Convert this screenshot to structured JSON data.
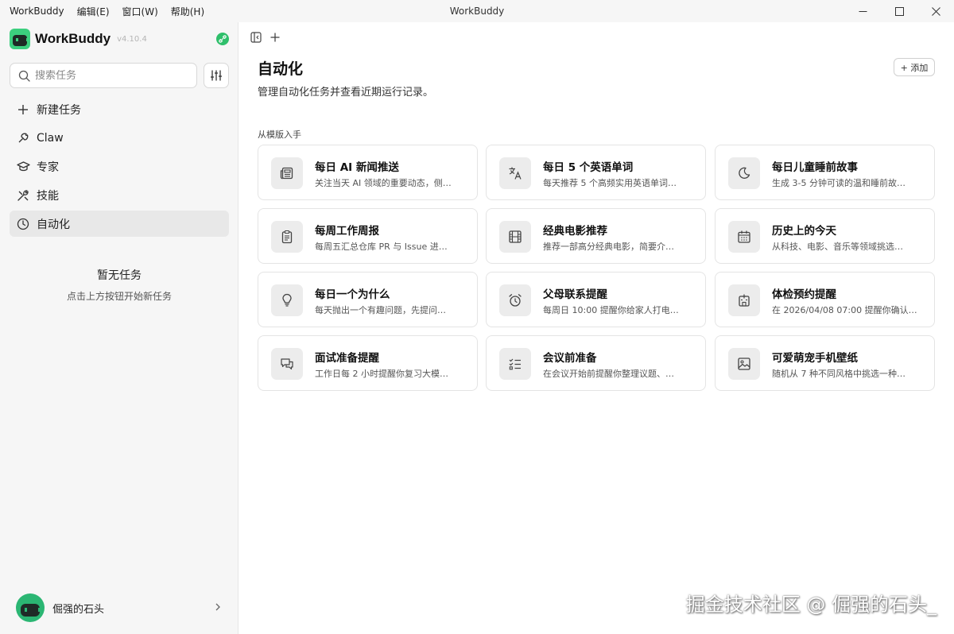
{
  "titlebar": {
    "app_title": "WorkBuddy",
    "menu": [
      "WorkBuddy",
      "编辑(E)",
      "窗口(W)",
      "帮助(H)"
    ]
  },
  "sidebar": {
    "brand": "WorkBuddy",
    "version": "v4.10.4",
    "search_placeholder": "搜索任务",
    "items": [
      {
        "label": "新建任务",
        "icon": "plus-icon"
      },
      {
        "label": "Claw",
        "icon": "claw-icon"
      },
      {
        "label": "专家",
        "icon": "graduation-cap-icon"
      },
      {
        "label": "技能",
        "icon": "tools-icon"
      },
      {
        "label": "自动化",
        "icon": "clock-icon",
        "active": true
      }
    ],
    "empty_title": "暂无任务",
    "empty_subtitle": "点击上方按钮开始新任务",
    "user_name": "倔强的石头"
  },
  "main": {
    "title": "自动化",
    "description": "管理自动化任务并查看近期运行记录。",
    "add_label": "+ 添加",
    "section_label": "从模版入手",
    "templates": [
      {
        "title": "每日 AI 新闻推送",
        "desc": "关注当天 AI 领域的重要动态，侧…",
        "icon": "newspaper-icon"
      },
      {
        "title": "每日 5 个英语单词",
        "desc": "每天推荐 5 个高频实用英语单词…",
        "icon": "translate-icon"
      },
      {
        "title": "每日儿童睡前故事",
        "desc": "生成 3-5 分钟可读的温和睡前故…",
        "icon": "moon-icon"
      },
      {
        "title": "每周工作周报",
        "desc": "每周五汇总仓库 PR 与 Issue 进…",
        "icon": "clipboard-icon"
      },
      {
        "title": "经典电影推荐",
        "desc": "推荐一部高分经典电影，简要介…",
        "icon": "film-icon"
      },
      {
        "title": "历史上的今天",
        "desc": "从科技、电影、音乐等领域挑选…",
        "icon": "calendar-icon"
      },
      {
        "title": "每日一个为什么",
        "desc": "每天抛出一个有趣问题，先提问…",
        "icon": "lightbulb-icon"
      },
      {
        "title": "父母联系提醒",
        "desc": "每周日 10:00 提醒你给家人打电…",
        "icon": "alarm-clock-icon"
      },
      {
        "title": "体检预约提醒",
        "desc": "在 2026/04/08 07:00 提醒你确认…",
        "icon": "hospital-icon"
      },
      {
        "title": "面试准备提醒",
        "desc": "工作日每 2 小时提醒你复习大模…",
        "icon": "chat-bubbles-icon"
      },
      {
        "title": "会议前准备",
        "desc": "在会议开始前提醒你整理议题、…",
        "icon": "checklist-icon"
      },
      {
        "title": "可爱萌宠手机壁纸",
        "desc": "随机从 7 种不同风格中挑选一种…",
        "icon": "image-icon"
      }
    ]
  },
  "watermark": "掘金技术社区 @ 倔强的石头_"
}
